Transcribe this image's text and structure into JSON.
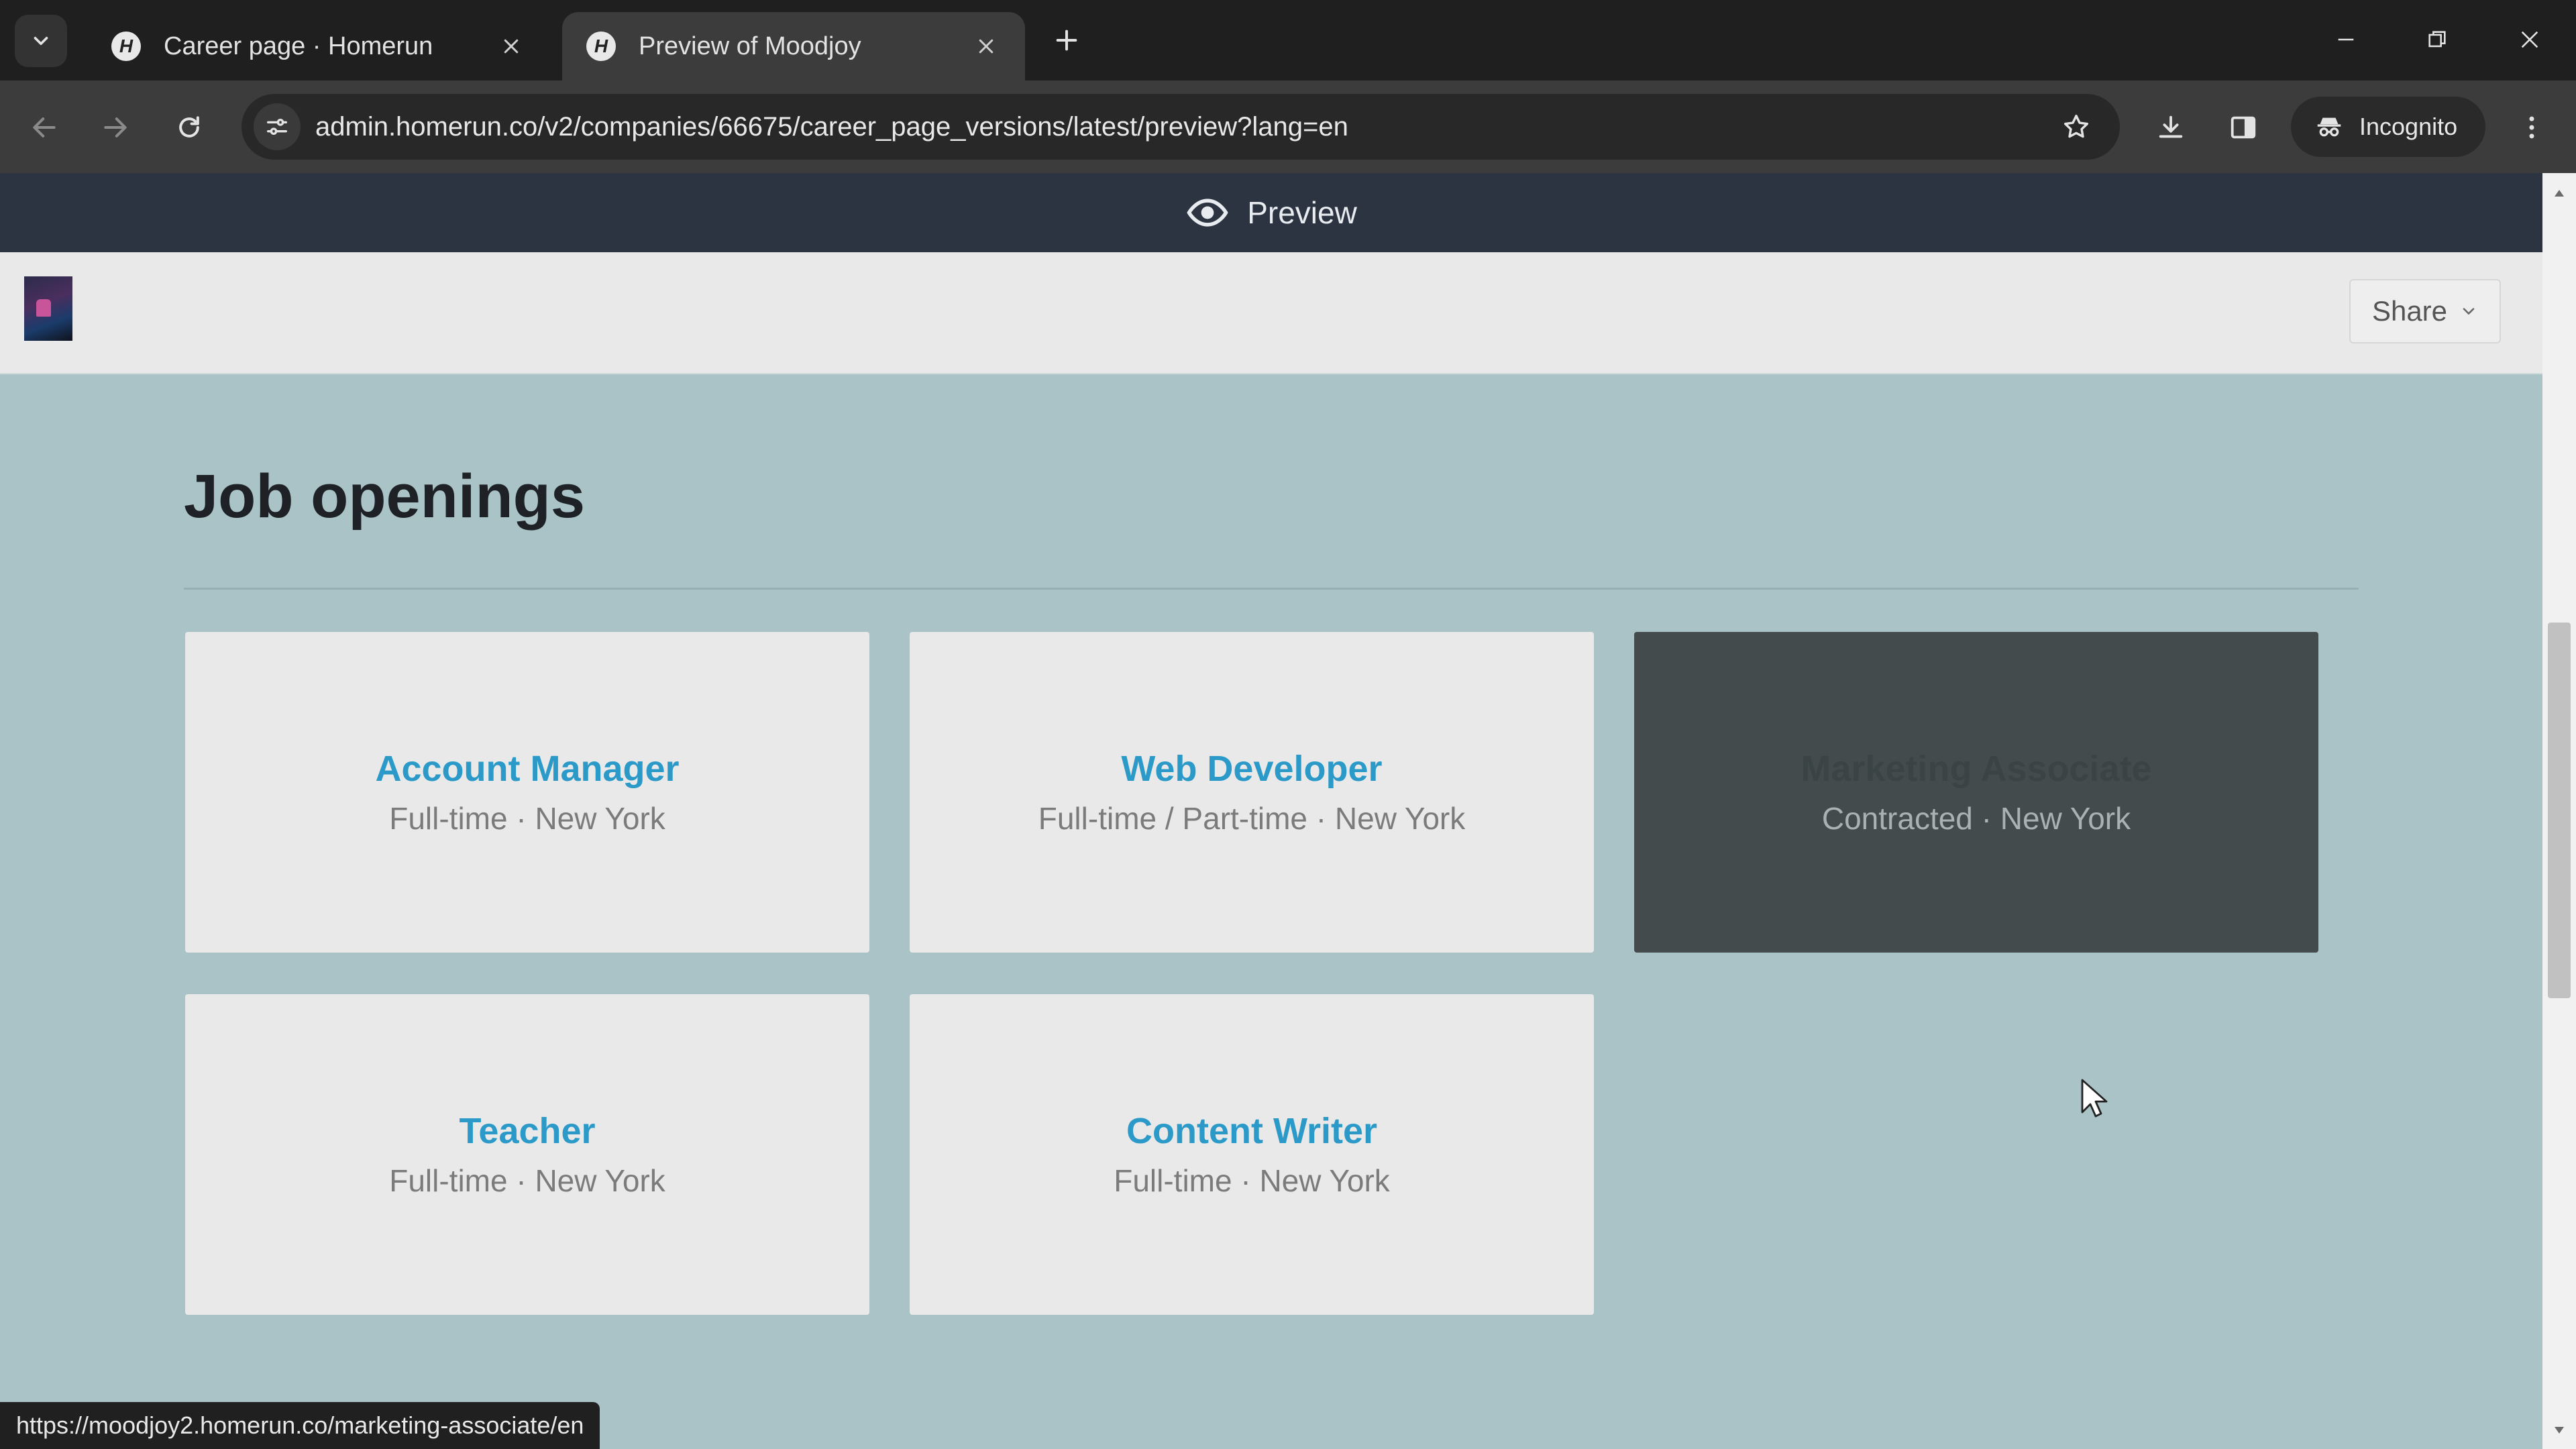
{
  "browser": {
    "tabs": [
      {
        "favicon": "H",
        "title": "Career page · Homerun",
        "active": false
      },
      {
        "favicon": "H",
        "title": "Preview of Moodjoy",
        "active": true
      }
    ],
    "url": "admin.homerun.co/v2/companies/66675/career_page_versions/latest/preview?lang=en",
    "profile_label": "Incognito",
    "status_url": "https://moodjoy2.homerun.co/marketing-associate/en"
  },
  "preview_bar": {
    "label": "Preview"
  },
  "header": {
    "share_label": "Share"
  },
  "jobs_section": {
    "title": "Job openings",
    "jobs": [
      {
        "title": "Account Manager",
        "meta": "Full-time · New York"
      },
      {
        "title": "Web Developer",
        "meta": "Full-time / Part-time · New York"
      },
      {
        "title": "Marketing Associate",
        "meta": "Contracted · New York",
        "hovered": true
      },
      {
        "title": "Teacher",
        "meta": "Full-time · New York"
      },
      {
        "title": "Content Writer",
        "meta": "Full-time · New York"
      }
    ]
  },
  "colors": {
    "page_background": "#a9c3c7",
    "job_title": "#2b9ac8",
    "preview_bar": "#2b3440",
    "hover_card": "#434b4c"
  }
}
